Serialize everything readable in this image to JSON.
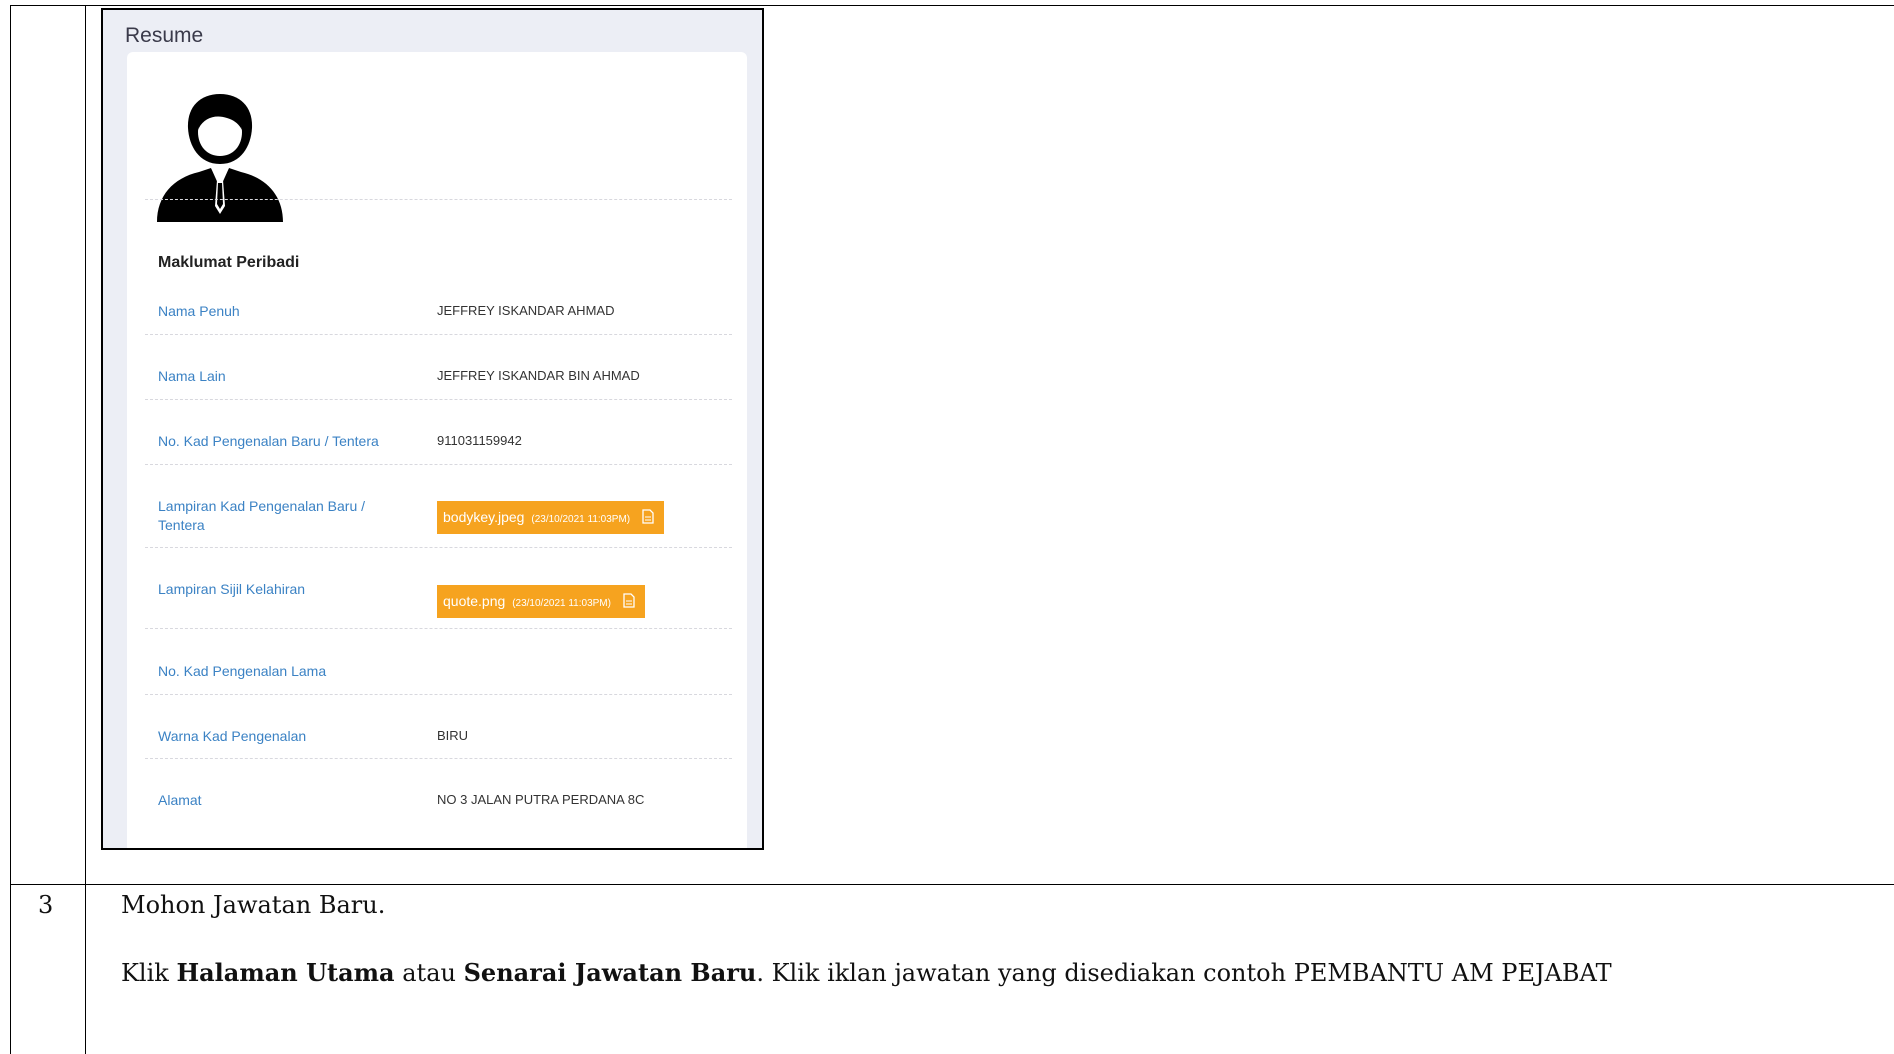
{
  "resume_panel": {
    "title": "Resume",
    "section_heading": "Maklumat Peribadi",
    "avatar_icon": "user-avatar-icon",
    "fields": [
      {
        "label": "Nama Penuh",
        "value": "JEFFREY ISKANDAR AHMAD"
      },
      {
        "label": "Nama Lain",
        "value": "JEFFREY ISKANDAR BIN AHMAD"
      },
      {
        "label": "No. Kad Pengenalan Baru / Tentera",
        "value": "911031159942"
      },
      {
        "label": "Lampiran Kad Pengenalan Baru / Tentera",
        "file_name": "bodykey.jpeg",
        "file_timestamp": "(23/10/2021 11:03PM)"
      },
      {
        "label": "Lampiran Sijil Kelahiran",
        "file_name": "quote.png",
        "file_timestamp": "(23/10/2021 11:03PM)"
      },
      {
        "label": "No. Kad Pengenalan Lama",
        "value": ""
      },
      {
        "label": "Warna Kad Pengenalan",
        "value": "BIRU"
      },
      {
        "label": "Alamat",
        "value": "NO 3 JALAN PUTRA PERDANA 8C"
      }
    ],
    "colors": {
      "label": "#3b82c4",
      "file_chip": "#f6a31f",
      "panel_bg": "#eceef5"
    },
    "file_icon": "document-icon"
  },
  "document": {
    "row_number": "3",
    "step_title": "Mohon Jawatan Baru.",
    "instruction": {
      "t1": "Klik ",
      "b1": "Halaman Utama",
      "t2": " atau ",
      "b2": "Senarai Jawatan Baru",
      "t3": ". Klik iklan jawatan yang disediakan contoh PEMBANTU AM PEJABAT"
    }
  }
}
